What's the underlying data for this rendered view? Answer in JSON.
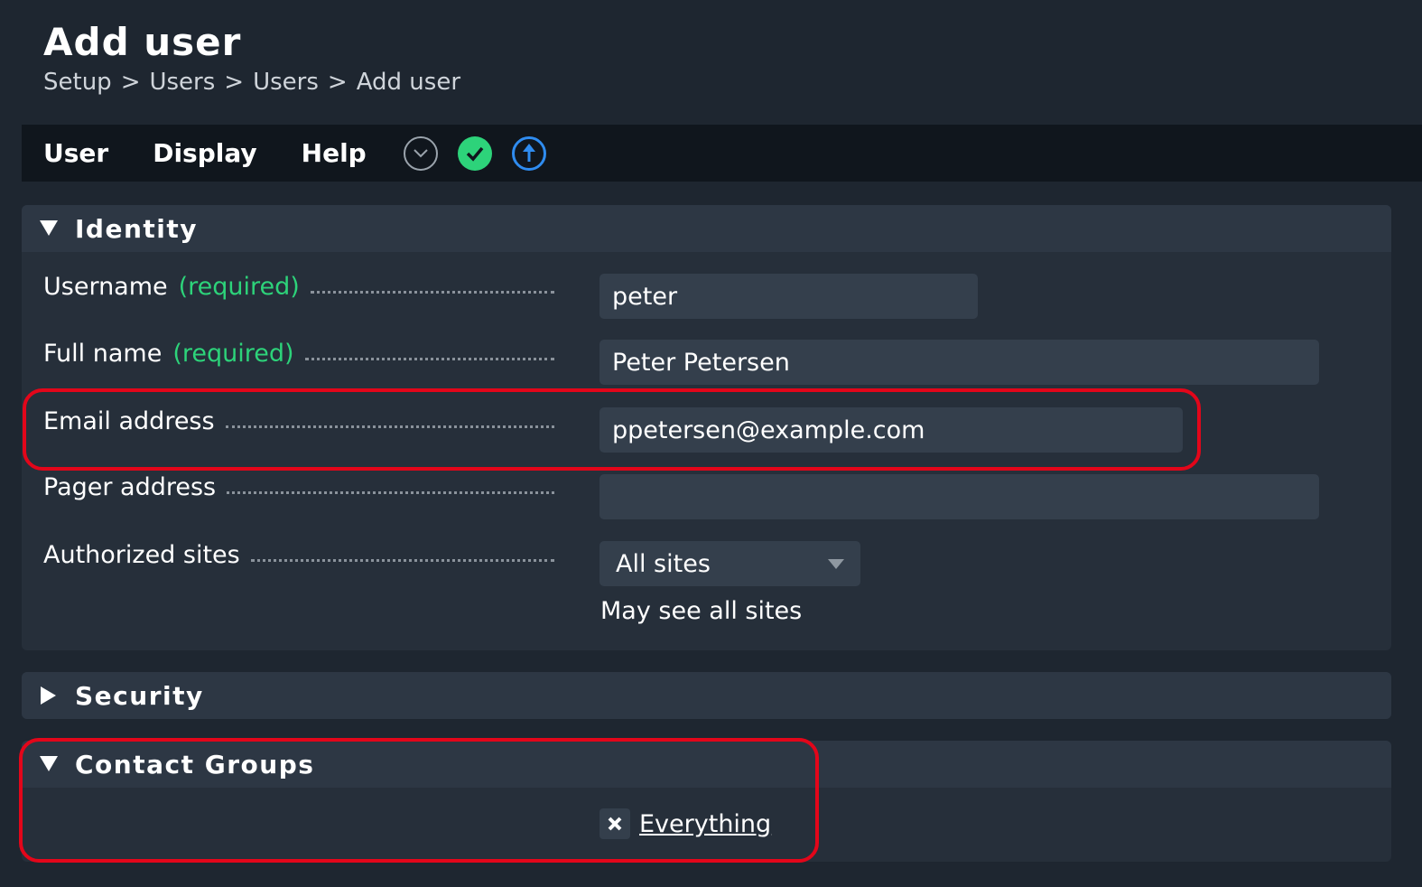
{
  "page": {
    "title": "Add user",
    "breadcrumb": [
      "Setup",
      "Users",
      "Users",
      "Add user"
    ],
    "breadcrumb_separator": ">"
  },
  "menubar": {
    "items": [
      "User",
      "Display",
      "Help"
    ],
    "icons": [
      "dropdown-circle-icon",
      "activate-checkmark-icon",
      "upload-arrow-icon"
    ]
  },
  "identity": {
    "title": "Identity",
    "required_text": "(required)",
    "username": {
      "label": "Username",
      "value": "peter"
    },
    "full_name": {
      "label": "Full name",
      "value": "Peter Petersen"
    },
    "email": {
      "label": "Email address",
      "value": "ppetersen@example.com"
    },
    "pager": {
      "label": "Pager address",
      "value": ""
    },
    "authorized_sites": {
      "label": "Authorized sites",
      "selected": "All sites",
      "hint": "May see all sites"
    }
  },
  "security": {
    "title": "Security"
  },
  "contact_groups": {
    "title": "Contact Groups",
    "items": [
      "Everything"
    ]
  },
  "colors": {
    "background": "#1e2630",
    "menubar": "#10161d",
    "accent_green": "#2dd37a",
    "accent_blue": "#2f8cf0",
    "highlight_red": "#e3061a"
  }
}
